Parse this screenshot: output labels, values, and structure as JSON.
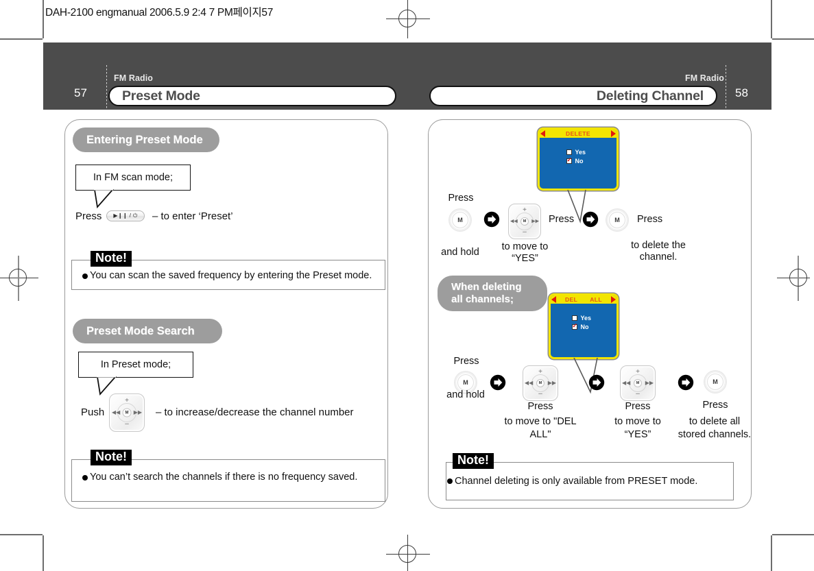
{
  "slug": "DAH-2100 engmanual  2006.5.9 2:4 7 PM페이지57",
  "header": {
    "left": {
      "folio": "57",
      "kicker": "FM Radio",
      "title": "Preset Mode"
    },
    "right": {
      "folio": "58",
      "kicker": "FM Radio",
      "title": "Deleting Channel"
    }
  },
  "left_page": {
    "section1": {
      "heading": "Entering Preset Mode",
      "balloon": "In FM scan mode;",
      "step_prefix": "Press",
      "key_label": "▶❙❙ / ⏻",
      "step_suffix": "– to enter ‘Preset’",
      "note": {
        "tag": "Note!",
        "text": "You can scan the saved frequency by entering the Preset mode."
      }
    },
    "section2": {
      "heading": "Preset Mode Search",
      "balloon": "In Preset mode;",
      "step_prefix": "Push",
      "step_suffix": "– to increase/decrease the channel number",
      "note": {
        "tag": "Note!",
        "text": "You can’t search the channels if there is no frequency saved."
      }
    }
  },
  "right_page": {
    "screen1": {
      "title": "DELETE",
      "rows": [
        {
          "label": "Yes",
          "checked": false
        },
        {
          "label": "No",
          "checked": true
        }
      ]
    },
    "screen2": {
      "title_left": "DEL",
      "title_right": "ALL",
      "rows": [
        {
          "label": "Yes",
          "checked": false
        },
        {
          "label": "No",
          "checked": true
        }
      ]
    },
    "flow1": {
      "s1_top": "Press",
      "s1_bottom": "and hold",
      "s1_key": "M",
      "s2_label": "Press",
      "s2_caption_l1": "to move to",
      "s2_caption_l2": "“YES”",
      "s3_label": "Press",
      "s3_key": "M",
      "s3_caption_l1": "to delete the",
      "s3_caption_l2": "channel."
    },
    "subheading": "When deleting all channels;",
    "flow2": {
      "s1_top": "Press",
      "s1_bottom": "and hold",
      "s1_key": "M",
      "s2_label": "Press",
      "s2_caption_l1": "to move to \"DEL",
      "s2_caption_l2": "ALL\"",
      "s3_label": "Press",
      "s3_caption_l1": "to move to",
      "s3_caption_l2": "“YES”",
      "s4_label": "Press",
      "s4_key": "M",
      "s4_caption_l1": "to delete all",
      "s4_caption_l2": "stored channels."
    },
    "note": {
      "tag": "Note!",
      "text": "Channel deleting is only available from PRESET mode."
    }
  },
  "joystick": {
    "plus": "+",
    "minus": "–",
    "prev": "◀◀",
    "next": "▶▶",
    "hub": "M"
  },
  "colors": {
    "header_band": "#4c4c4c",
    "pill": "#9d9d9d",
    "lcd_bg": "#1267b0",
    "lcd_border": "#f2e500",
    "lcd_title_text": "#e8521a",
    "lcd_arrow": "#e01b0f"
  }
}
